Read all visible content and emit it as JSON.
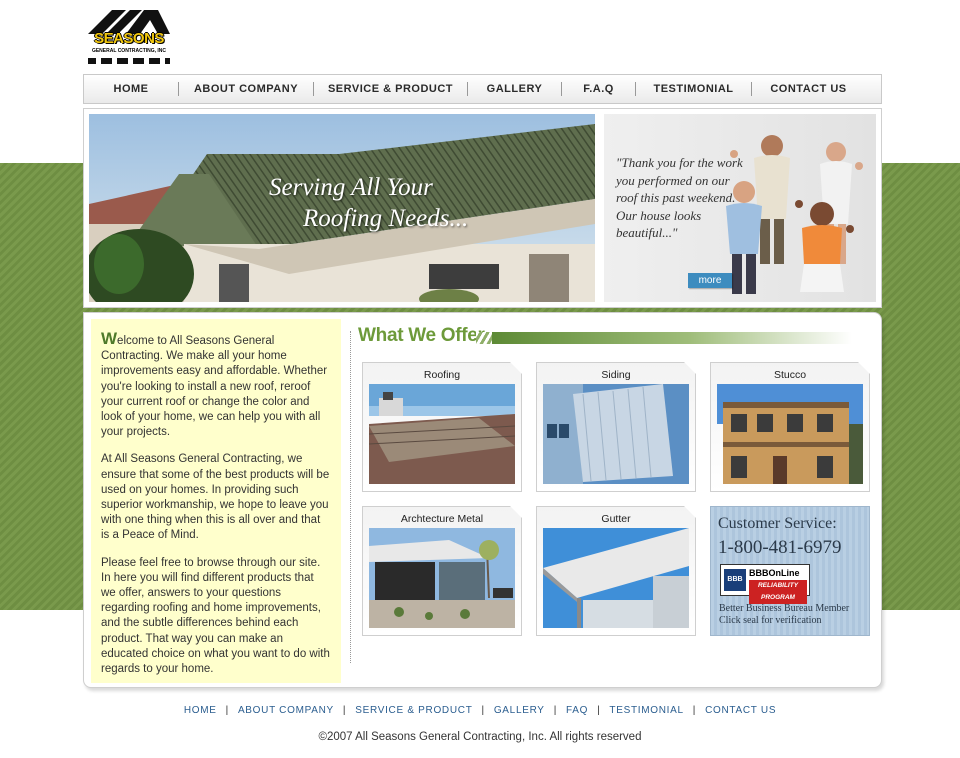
{
  "logo": {
    "word": "SEASONS",
    "tagline": "GENERAL CONTRACTING, INC"
  },
  "nav": {
    "items": [
      {
        "label": "HOME"
      },
      {
        "label": "ABOUT COMPANY"
      },
      {
        "label": "SERVICE & PRODUCT"
      },
      {
        "label": "GALLERY"
      },
      {
        "label": "F.A.Q"
      },
      {
        "label": "TESTIMONIAL"
      },
      {
        "label": "CONTACT US"
      }
    ]
  },
  "hero": {
    "caption_line1": "Serving All Your",
    "caption_line2": "Roofing Needs...",
    "quote": "\"Thank you for the work you performed on our roof this past weekend. Our house looks beautiful...\"",
    "more_label": "more"
  },
  "welcome": {
    "dropcap": "W",
    "p1": "elcome to All Seasons General Contracting. We make all your home improvements easy and affordable. Whether you're looking to install a new roof, reroof your current roof or change the color and look of your home, we can help you with all your projects.",
    "p2": "At All Seasons General Contracting, we ensure that some of the best products will be used on your homes. In providing such superior workmanship, we hope to leave you with one thing when this is all over and that is a Peace of Mind.",
    "p3": "Please feel free to browse through our site. In here you will find different products that we offer, answers to your questions regarding roofing and home improvements, and the subtle differences behind each product. That way you can make an educated choice on what you want to do with regards to your home."
  },
  "offer": {
    "title": "What We Offer",
    "cards": [
      {
        "label": "Roofing"
      },
      {
        "label": "Siding"
      },
      {
        "label": "Stucco"
      },
      {
        "label": "Archtecture Metal"
      },
      {
        "label": "Gutter"
      }
    ]
  },
  "customer_service": {
    "title": "Customer Service:",
    "phone": "1-800-481-6979",
    "bbb_logo": "BBB",
    "bbb_online": "BBBOnLine",
    "bbb_program": "RELIABILITY PROGRAM",
    "note_line1": "Better Business Bureau Member",
    "note_line2": "Click seal for verification"
  },
  "footer": {
    "links": [
      {
        "label": "HOME"
      },
      {
        "label": "ABOUT COMPANY"
      },
      {
        "label": "SERVICE & PRODUCT"
      },
      {
        "label": "GALLERY"
      },
      {
        "label": "FAQ"
      },
      {
        "label": "TESTIMONIAL"
      },
      {
        "label": "CONTACT US"
      }
    ],
    "separator": "|",
    "copyright": "©2007 All Seasons General Contracting, Inc. All rights reserved"
  },
  "colors": {
    "band_green": "#7a9a4c",
    "offer_green": "#6d9a3a",
    "link_blue": "#2a5d8f",
    "welcome_bg": "#ffffcc",
    "more_button": "#3d8cbf"
  }
}
